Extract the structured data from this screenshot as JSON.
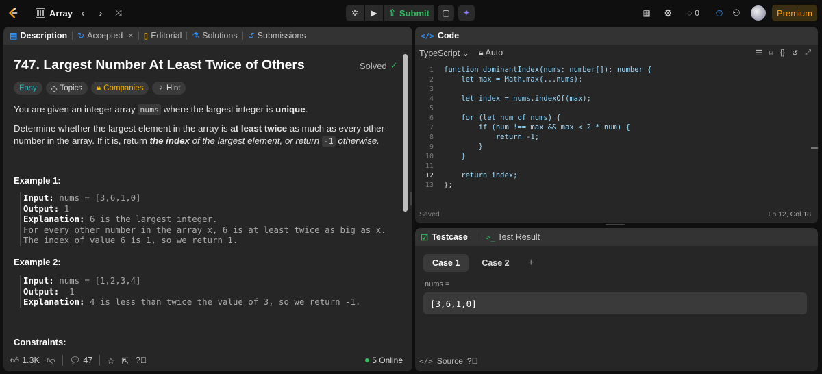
{
  "topbar": {
    "problem_list_label": "Array",
    "submit_label": "Submit",
    "streak_count": "0",
    "premium_label": "Premium",
    "icons": [
      "leetcode-logo",
      "chevron-left",
      "chevron-right",
      "shuffle",
      "debug",
      "play",
      "upload",
      "notebook",
      "sparkle",
      "layout",
      "gear",
      "fire",
      "timer",
      "add-user",
      "avatar"
    ]
  },
  "left": {
    "tabs": [
      {
        "label": "Description",
        "icon": "doc-icon"
      },
      {
        "label": "Accepted",
        "icon": "clock-icon"
      },
      {
        "label": "Editorial",
        "icon": "book-icon"
      },
      {
        "label": "Solutions",
        "icon": "flask-icon"
      },
      {
        "label": "Submissions",
        "icon": "history-icon"
      }
    ],
    "close_glyph": "×",
    "title": "747. Largest Number At Least Twice of Others",
    "solved_label": "Solved",
    "chips": {
      "difficulty": "Easy",
      "topics": "Topics",
      "companies": "Companies",
      "hint": "Hint"
    },
    "p1": {
      "pre": "You are given an integer array ",
      "code": "nums",
      "mid": " where the largest integer is ",
      "bold": "unique",
      "post": "."
    },
    "p2": {
      "pre": "Determine whether the largest element in the array is ",
      "bold": "at least twice",
      "mid": " as much as every other number in the array. If it is, return ",
      "italic_bold": "the index",
      "italic": " of the largest element, or return ",
      "code": "-1",
      "post": " otherwise."
    },
    "example1": {
      "heading": "Example 1:",
      "input_label": "Input:",
      "input_value": "nums = [3,6,1,0]",
      "output_label": "Output:",
      "output_value": "1",
      "expl_label": "Explanation:",
      "expl_lines": [
        "6 is the largest integer.",
        "For every other number in the array x, 6 is at least twice as big as x.",
        "The index of value 6 is 1, so we return 1."
      ]
    },
    "example2": {
      "heading": "Example 2:",
      "input_label": "Input:",
      "input_value": "nums = [1,2,3,4]",
      "output_label": "Output:",
      "output_value": "-1",
      "expl_label": "Explanation:",
      "expl_text": "4 is less than twice the value of 3, so we return -1."
    },
    "constraints_heading": "Constraints:",
    "footer": {
      "likes": "1.3K",
      "comments": "47",
      "online": "5 Online"
    }
  },
  "code": {
    "header": "Code",
    "language": "TypeScript",
    "mode": "Auto",
    "lines": [
      "function dominantIndex(nums: number[]): number {",
      "    let max = Math.max(...nums);",
      "",
      "    let index = nums.indexOf(max);",
      "",
      "    for (let num of nums) {",
      "        if (num !== max && max < 2 * num) {",
      "            return -1;",
      "        }",
      "    }",
      "",
      "    return index;",
      "};"
    ],
    "current_line": 12,
    "saved_label": "Saved",
    "cursor_label": "Ln 12, Col 18"
  },
  "test": {
    "tabs": [
      "Testcase",
      "Test Result"
    ],
    "cases": [
      "Case 1",
      "Case 2"
    ],
    "add_glyph": "+",
    "var_name": "nums =",
    "var_value": "[3,6,1,0]",
    "source_label": "Source"
  },
  "colors": {
    "accent_green": "#2cbb5d",
    "premium": "#ffa116",
    "easy": "#1cb8b8",
    "companies": "#ffb800",
    "blue": "#2f95ff"
  }
}
